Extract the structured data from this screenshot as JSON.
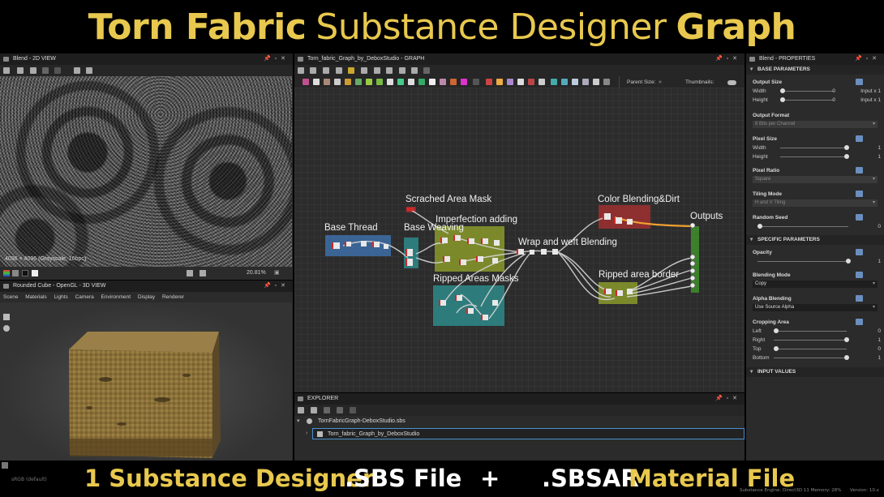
{
  "banner": {
    "top_bold_1": "Torn Fabric",
    "top_regular": "Substance Designer",
    "top_bold_2": "Graph",
    "bottom_1": "1 Substance Designer",
    "bottom_2": ".SBS File",
    "bottom_plus": "+",
    "bottom_3": ".SBSAR",
    "bottom_4": "Material File"
  },
  "view2d": {
    "title": "Blend - 2D VIEW",
    "image_info": "4096 × 4096 (Grayscale, 16bpc)",
    "zoom": "20.81%"
  },
  "view3d": {
    "title": "Rounded Cube - OpenGL - 3D VIEW",
    "menu": [
      "Scene",
      "Materials",
      "Lights",
      "Camera",
      "Environment",
      "Display",
      "Renderer"
    ]
  },
  "graph": {
    "title": "Torn_fabric_Graph_by_DeboxStudio - GRAPH",
    "parent_size_label": "Parent Size:",
    "thumbnails_label": "Thumbnails:",
    "frames": [
      {
        "label": "Scrached Area Mask"
      },
      {
        "label": "Base Thread"
      },
      {
        "label": "Base Weaving"
      },
      {
        "label": "Imperfection adding"
      },
      {
        "label": "Wrap and weft Blending"
      },
      {
        "label": "Ripped Areas Masks"
      },
      {
        "label": "Color Blending&Dirt"
      },
      {
        "label": "Outputs"
      },
      {
        "label": "Ripped area border"
      }
    ]
  },
  "explorer": {
    "title": "EXPLORER",
    "package": "TornFabricGraph-DeboxStudio.sbs",
    "graph_item": "Torn_fabric_Graph_by_DeboxStudio"
  },
  "properties": {
    "title": "Blend - PROPERTIES",
    "base_section": "BASE PARAMETERS",
    "output_size": "Output Size",
    "width": "Width",
    "height": "Height",
    "width_val": "0",
    "height_val": "0",
    "input_x1": "Input x 1",
    "output_format": "Output Format",
    "output_format_val": "8 Bits per Channel",
    "pixel_size": "Pixel Size",
    "pixel_size_val": "1",
    "pixel_ratio": "Pixel Ratio",
    "pixel_ratio_val": "Square",
    "tiling_mode": "Tiling Mode",
    "tiling_mode_val": "H and V Tiling",
    "random_seed": "Random Seed",
    "random_seed_val": "0",
    "specific_section": "SPECIFIC PARAMETERS",
    "opacity": "Opacity",
    "opacity_val": "1",
    "blending_mode": "Blending Mode",
    "blending_mode_val": "Copy",
    "alpha_blending": "Alpha Blending",
    "alpha_blending_val": "Use Source Alpha",
    "cropping_area": "Cropping Area",
    "left": "Left",
    "right": "Right",
    "top": "Top",
    "bottom": "Bottom",
    "left_val": "0",
    "right_val": "1",
    "top_val": "0",
    "bottom_val": "1",
    "input_section": "INPUT VALUES"
  },
  "status": {
    "colorspace": "sRGB (default)",
    "engine": "Substance Engine: Direct3D 11  Memory: 28%",
    "version": "Version: 10.x"
  },
  "colors": {
    "gold": "#e8c84e",
    "frame_blue": "#3e6ea8",
    "frame_teal": "#2f8a8a",
    "frame_olive": "#8a9a2c",
    "frame_red": "#a03030",
    "frame_green": "#3e8a2c"
  }
}
